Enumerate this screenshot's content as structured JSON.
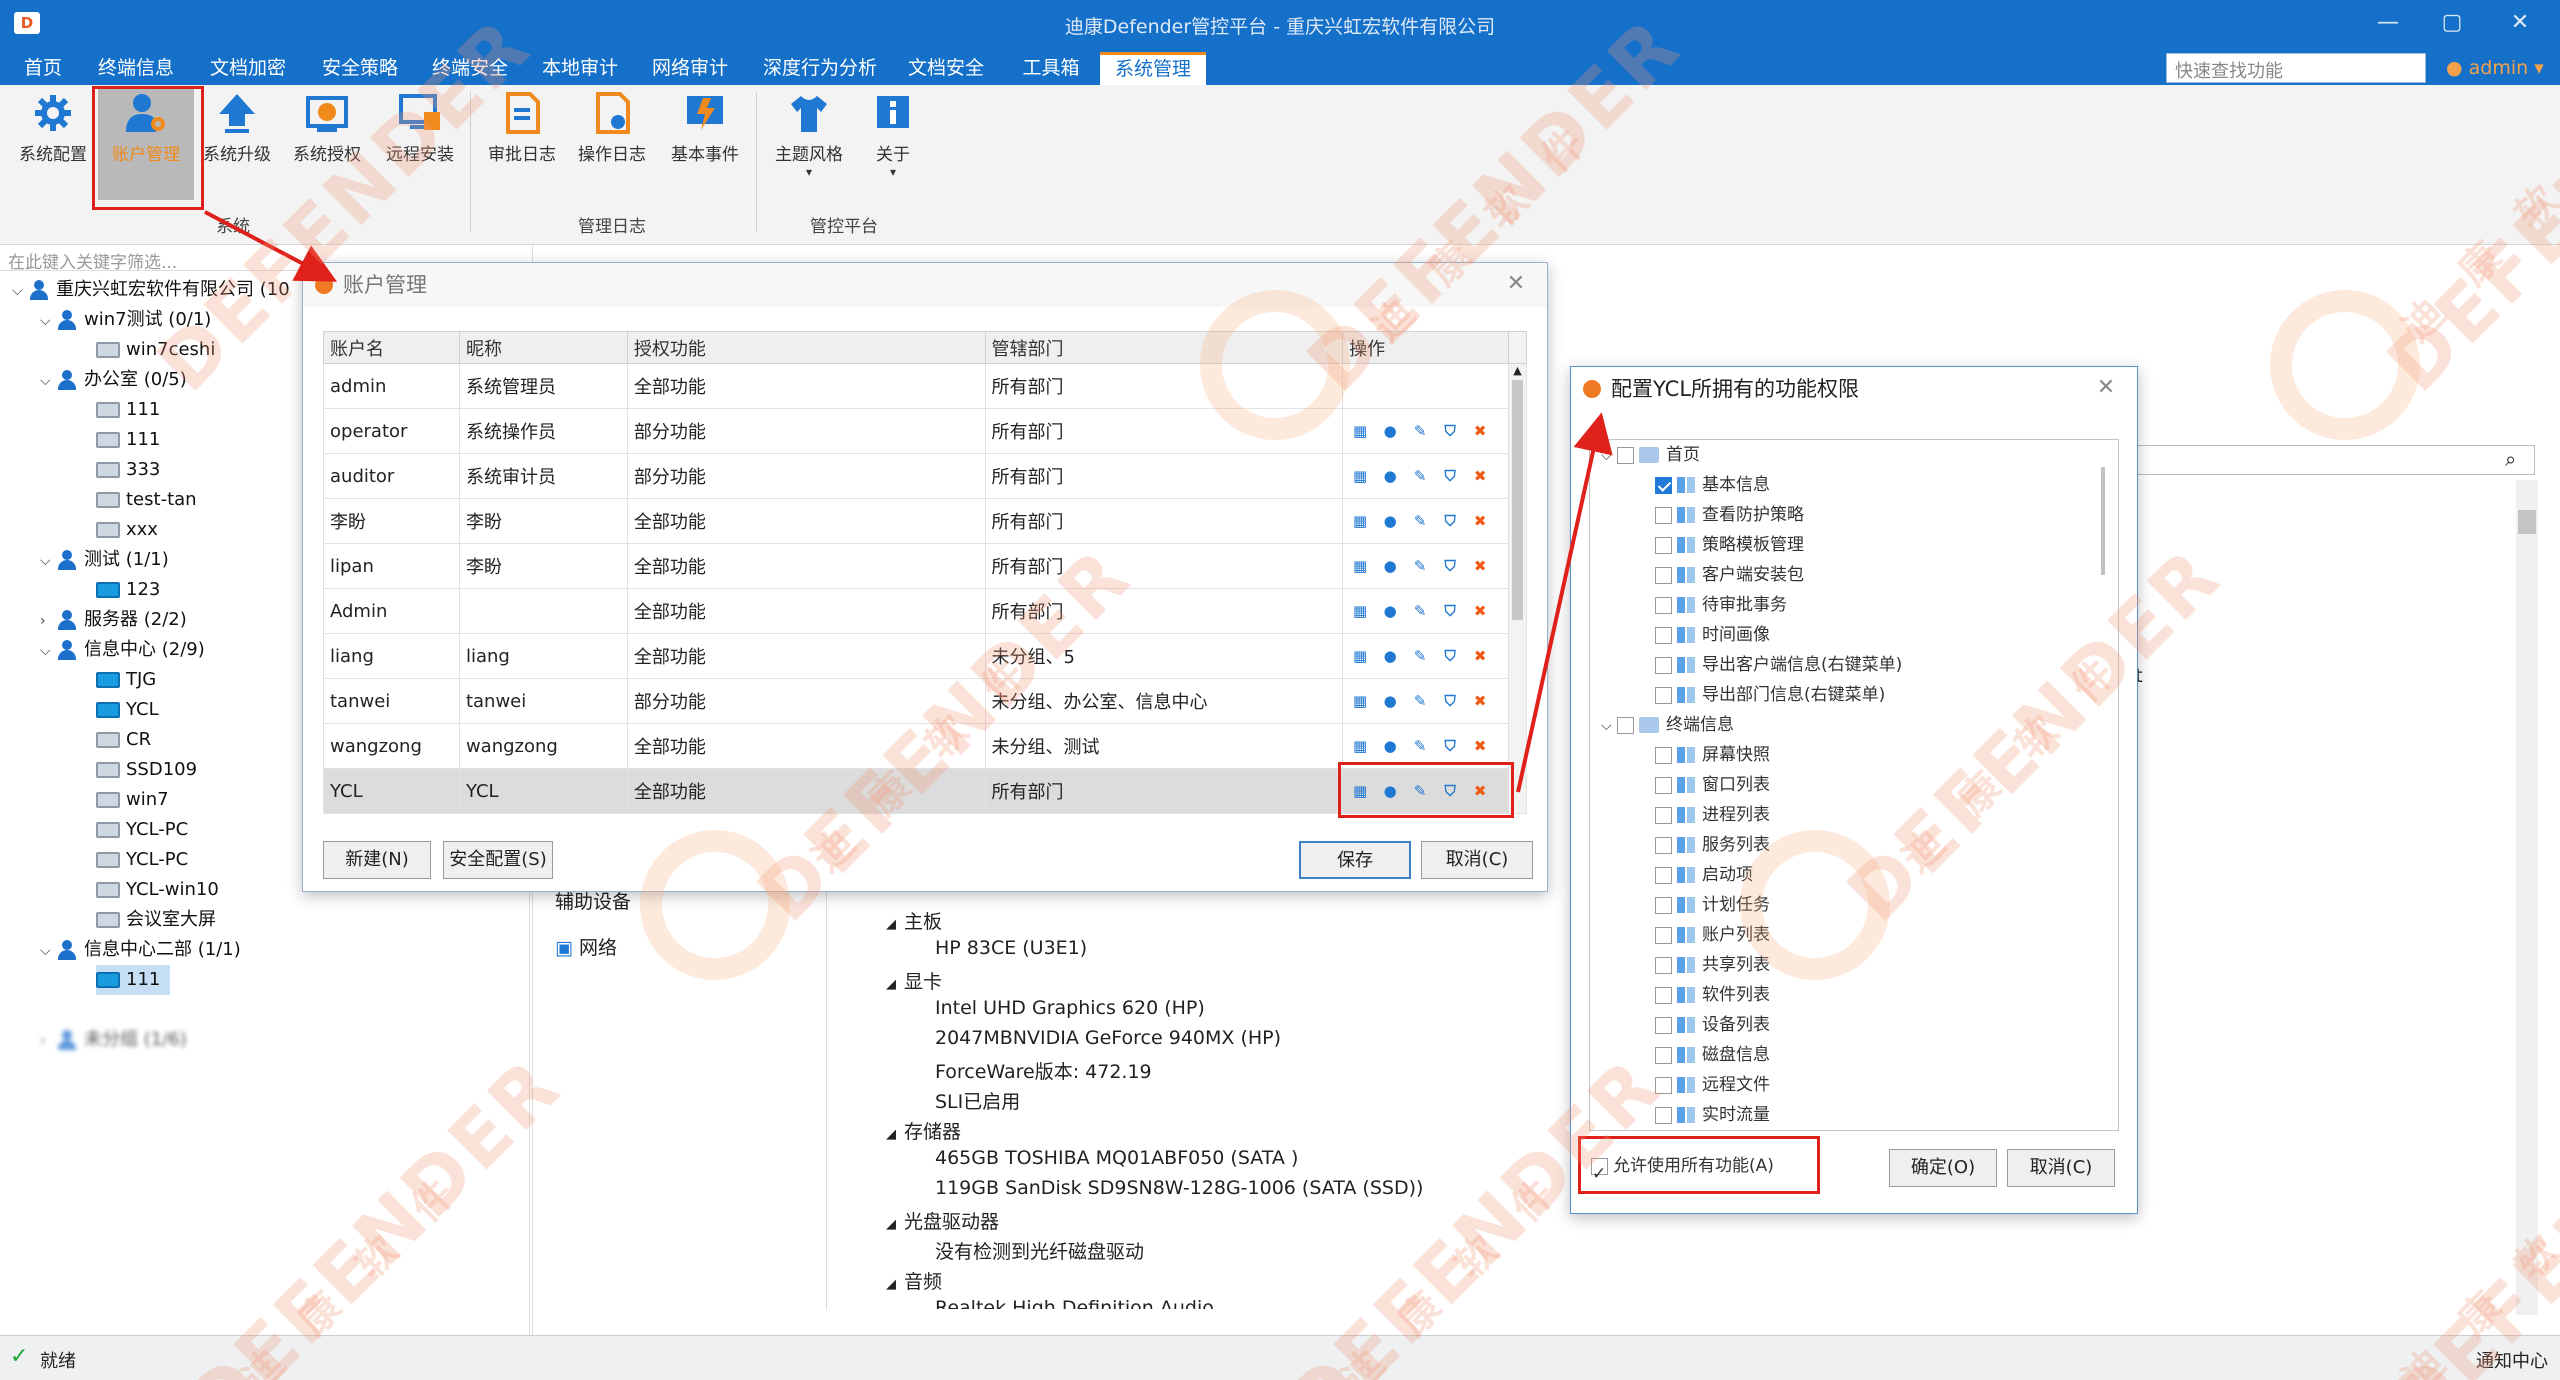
{
  "window": {
    "title": "迪康Defender管控平台 - 重庆兴虹宏软件有限公司",
    "app_icon_text": "D"
  },
  "menu": [
    "首页",
    "终端信息",
    "文档加密",
    "安全策略",
    "终端安全",
    "本地审计",
    "网络审计",
    "深度行为分析",
    "文档安全",
    "工具箱",
    "系统管理"
  ],
  "quick_search": {
    "placeholder": "快速查找功能"
  },
  "user": {
    "name": "admin"
  },
  "ribbon": {
    "buttons": [
      "系统配置",
      "账户管理",
      "系统升级",
      "系统授权",
      "远程安装",
      "审批日志",
      "操作日志",
      "基本事件",
      "主题风格",
      "关于"
    ],
    "groups": [
      "系统",
      "管理日志",
      "管控平台"
    ]
  },
  "tree": {
    "search_placeholder": "在此键入关键字筛选...",
    "nodes": [
      {
        "label": "重庆兴虹宏软件有限公司 (10"
      },
      {
        "label": "win7测试 (0/1)"
      },
      {
        "label": "win7ceshi"
      },
      {
        "label": "办公室 (0/5)"
      },
      {
        "label": "111"
      },
      {
        "label": "111"
      },
      {
        "label": "333"
      },
      {
        "label": "test-tan"
      },
      {
        "label": "xxx"
      },
      {
        "label": "测试 (1/1)"
      },
      {
        "label": "123"
      },
      {
        "label": "服务器 (2/2)"
      },
      {
        "label": "信息中心 (2/9)"
      },
      {
        "label": "TJG"
      },
      {
        "label": "YCL"
      },
      {
        "label": "CR"
      },
      {
        "label": "SSD109"
      },
      {
        "label": "win7"
      },
      {
        "label": "YCL-PC"
      },
      {
        "label": "YCL-PC"
      },
      {
        "label": "YCL-win10"
      },
      {
        "label": "会议室大屏"
      },
      {
        "label": "信息中心二部 (1/1)"
      },
      {
        "label": "111"
      },
      {
        "label": "未分组 (1/6)"
      }
    ]
  },
  "hardware": {
    "left_items": [
      "辅助设备",
      "网络"
    ],
    "lines": [
      "主板",
      "HP 83CE (U3E1)",
      "显卡",
      "Intel UHD Graphics 620 (HP)",
      "2047MBNVIDIA GeForce 940MX (HP)",
      "ForceWare版本: 472.19",
      "SLI已启用",
      "存储器",
      "465GB TOSHIBA MQ01ABF050 (SATA )",
      "119GB SanDisk SD9SN8W-128G-1006 (SATA (SSD))",
      "光盘驱动器",
      "没有检测到光纤磁盘驱动",
      "音频",
      "Realtek High Definition Audio"
    ]
  },
  "account_dialog": {
    "title": "账户管理",
    "columns": [
      "账户名",
      "昵称",
      "授权功能",
      "管辖部门",
      "操作"
    ],
    "rows": [
      [
        "admin",
        "系统管理员",
        "全部功能",
        "所有部门"
      ],
      [
        "operator",
        "系统操作员",
        "部分功能",
        "所有部门"
      ],
      [
        "auditor",
        "系统审计员",
        "部分功能",
        "所有部门"
      ],
      [
        "李盼",
        "李盼",
        "全部功能",
        "所有部门"
      ],
      [
        "lipan",
        "李盼",
        "全部功能",
        "所有部门"
      ],
      [
        "Admin",
        "",
        "全部功能",
        "所有部门"
      ],
      [
        "liang",
        "liang",
        "全部功能",
        "未分组、5"
      ],
      [
        "tanwei",
        "tanwei",
        "部分功能",
        "未分组、办公室、信息中心"
      ],
      [
        "wangzong",
        "wangzong",
        "全部功能",
        "未分组、测试"
      ],
      [
        "YCL",
        "YCL",
        "全部功能",
        "所有部门"
      ]
    ],
    "buttons": {
      "new": "新建(N)",
      "security": "安全配置(S)",
      "save": "保存",
      "cancel": "取消(C)"
    }
  },
  "perm_dialog": {
    "title": "配置YCL所拥有的功能权限",
    "sections": [
      {
        "label": "首页",
        "items": [
          {
            "label": "基本信息",
            "checked": true
          },
          {
            "label": "查看防护策略"
          },
          {
            "label": "策略模板管理"
          },
          {
            "label": "客户端安装包"
          },
          {
            "label": "待审批事务"
          },
          {
            "label": "时间画像"
          },
          {
            "label": "导出客户端信息(右键菜单)"
          },
          {
            "label": "导出部门信息(右键菜单)"
          }
        ]
      },
      {
        "label": "终端信息",
        "items": [
          {
            "label": "屏幕快照"
          },
          {
            "label": "窗口列表"
          },
          {
            "label": "进程列表"
          },
          {
            "label": "服务列表"
          },
          {
            "label": "启动项"
          },
          {
            "label": "计划任务"
          },
          {
            "label": "账户列表"
          },
          {
            "label": "共享列表"
          },
          {
            "label": "软件列表"
          },
          {
            "label": "设备列表"
          },
          {
            "label": "磁盘信息"
          },
          {
            "label": "远程文件"
          },
          {
            "label": "实时流量"
          }
        ]
      }
    ],
    "allow_all": "允许使用所有功能(A)",
    "ok": "确定(O)",
    "cancel": "取消(C)"
  },
  "status": {
    "text": "就绪",
    "notify": "通知中心",
    "stray": "it"
  },
  "watermark": {
    "brand": "DEFENDER",
    "sub": "迪康软件"
  },
  "colors": {
    "accent": "#1570c9",
    "highlight": "#e0201a",
    "orange": "#f08a1c"
  }
}
